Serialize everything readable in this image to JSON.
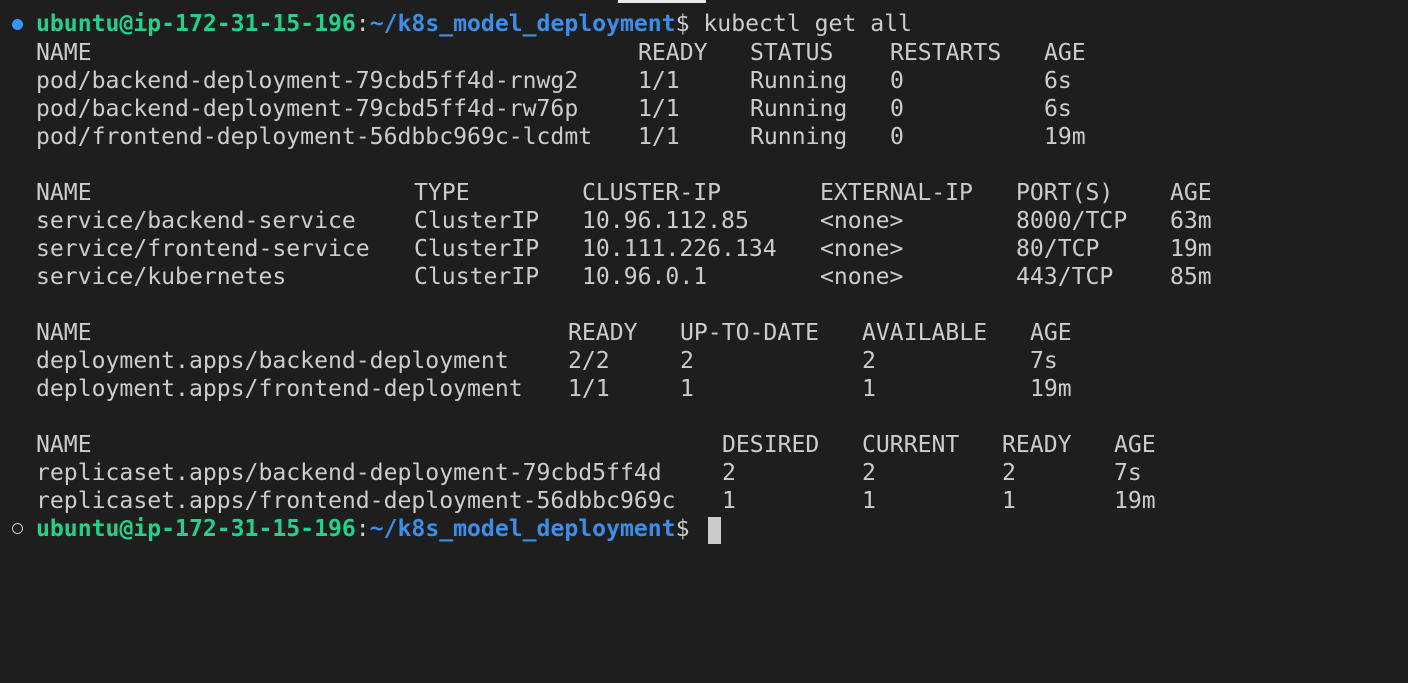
{
  "prompt": {
    "user_host": "ubuntu@ip-172-31-15-196",
    "colon": ":",
    "path": "~/k8s_model_deployment",
    "dollar": "$",
    "command": " kubectl get all"
  },
  "pods": {
    "headers": [
      "NAME",
      "READY",
      "STATUS",
      "RESTARTS",
      "AGE"
    ],
    "rows": [
      [
        "pod/backend-deployment-79cbd5ff4d-rnwg2",
        "1/1",
        "Running",
        "0",
        "6s"
      ],
      [
        "pod/backend-deployment-79cbd5ff4d-rw76p",
        "1/1",
        "Running",
        "0",
        "6s"
      ],
      [
        "pod/frontend-deployment-56dbbc969c-lcdmt",
        "1/1",
        "Running",
        "0",
        "19m"
      ]
    ]
  },
  "services": {
    "headers": [
      "NAME",
      "TYPE",
      "CLUSTER-IP",
      "EXTERNAL-IP",
      "PORT(S)",
      "AGE"
    ],
    "rows": [
      [
        "service/backend-service",
        "ClusterIP",
        "10.96.112.85",
        "<none>",
        "8000/TCP",
        "63m"
      ],
      [
        "service/frontend-service",
        "ClusterIP",
        "10.111.226.134",
        "<none>",
        "80/TCP",
        "19m"
      ],
      [
        "service/kubernetes",
        "ClusterIP",
        "10.96.0.1",
        "<none>",
        "443/TCP",
        "85m"
      ]
    ]
  },
  "deployments": {
    "headers": [
      "NAME",
      "READY",
      "UP-TO-DATE",
      "AVAILABLE",
      "AGE"
    ],
    "rows": [
      [
        "deployment.apps/backend-deployment",
        "2/2",
        "2",
        "2",
        "7s"
      ],
      [
        "deployment.apps/frontend-deployment",
        "1/1",
        "1",
        "1",
        "19m"
      ]
    ]
  },
  "replicasets": {
    "headers": [
      "NAME",
      "DESIRED",
      "CURRENT",
      "READY",
      "AGE"
    ],
    "rows": [
      [
        "replicaset.apps/backend-deployment-79cbd5ff4d",
        "2",
        "2",
        "2",
        "7s"
      ],
      [
        "replicaset.apps/frontend-deployment-56dbbc969c",
        "1",
        "1",
        "1",
        "19m"
      ]
    ]
  },
  "colors": {
    "background": "#1e1e1e",
    "text": "#cccccc",
    "user_host": "#23d18b",
    "path": "#3b8eea",
    "status_dot_success": "#3794ff"
  },
  "icons": {
    "command_status_done": "filled-circle",
    "command_status_pending": "hollow-circle"
  }
}
